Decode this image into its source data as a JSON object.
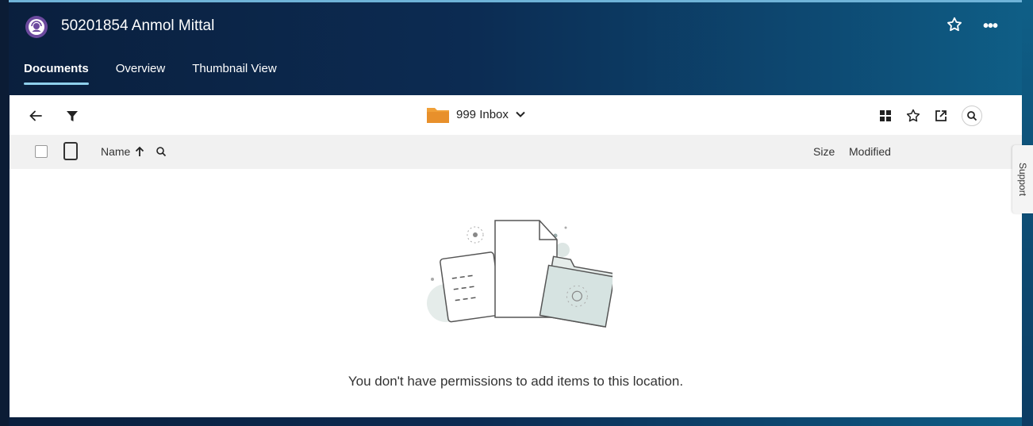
{
  "header": {
    "title": "50201854 Anmol Mittal",
    "avatar_icon": "headset-user-icon",
    "favorite_icon": "star-outline-icon",
    "more_label": "•••"
  },
  "tabs": [
    {
      "label": "Documents",
      "active": true
    },
    {
      "label": "Overview",
      "active": false
    },
    {
      "label": "Thumbnail View",
      "active": false
    }
  ],
  "toolbar": {
    "back_icon": "arrow-left-icon",
    "filter_icon": "filter-icon",
    "folder_name": "999 Inbox",
    "folder_icon": "folder-icon",
    "dropdown_icon": "chevron-down-icon",
    "right_icons": [
      "grid-view-icon",
      "star-outline-icon",
      "open-external-icon",
      "search-icon"
    ]
  },
  "columns": {
    "name": "Name",
    "size": "Size",
    "modified": "Modified"
  },
  "empty_state": {
    "message": "You don't have permissions to add items to this location."
  },
  "support": {
    "label": "Support"
  },
  "colors": {
    "accent_tab_underline": "#8fd0ec",
    "folder": "#e8902b",
    "header_dark": "#0c2b52"
  }
}
